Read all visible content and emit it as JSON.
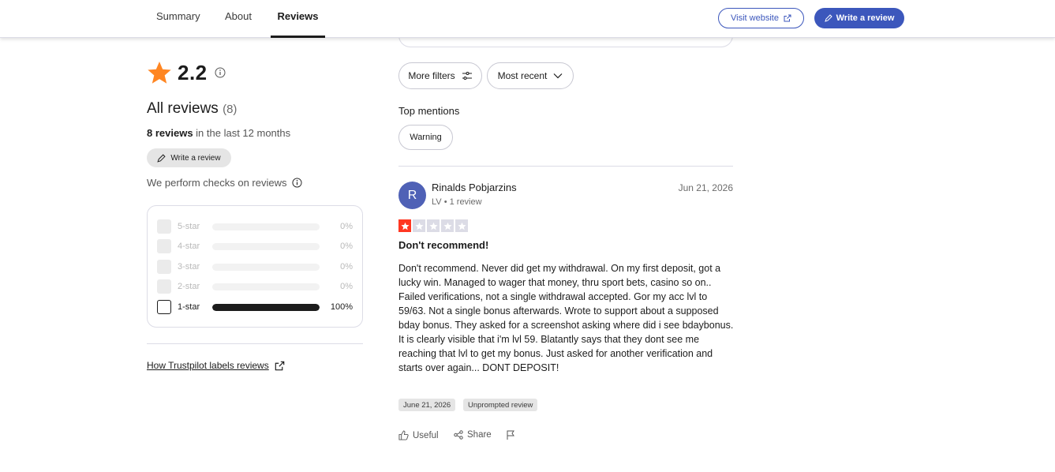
{
  "nav": {
    "tabs": [
      {
        "label": "Summary"
      },
      {
        "label": "About"
      },
      {
        "label": "Reviews"
      }
    ],
    "visit_website": "Visit website",
    "write_review": "Write a review"
  },
  "summary": {
    "rating": "2.2",
    "all_reviews_label": "All reviews",
    "all_reviews_count": "(8)",
    "reviews_count_bold": "8 reviews",
    "reviews_period": " in the last 12 months",
    "write_review": "Write a review",
    "checks_text": "We perform checks on reviews",
    "distribution": [
      {
        "label": "5-star",
        "percent_text": "0%",
        "percent": 0
      },
      {
        "label": "4-star",
        "percent_text": "0%",
        "percent": 0
      },
      {
        "label": "3-star",
        "percent_text": "0%",
        "percent": 0
      },
      {
        "label": "2-star",
        "percent_text": "0%",
        "percent": 0
      },
      {
        "label": "1-star",
        "percent_text": "100%",
        "percent": 100
      }
    ],
    "labels_link": "How Trustpilot labels reviews"
  },
  "filters": {
    "more_filters": "More filters",
    "sort": "Most recent",
    "top_mentions_title": "Top mentions",
    "mentions": [
      "Warning"
    ]
  },
  "review": {
    "avatar_initial": "R",
    "name": "Rinalds Pobjarzins",
    "meta": "LV • 1 review",
    "date": "Jun 21, 2026",
    "stars": 1,
    "title": "Don't recommend!",
    "body": "Don't recommend. Never did get my withdrawal. On my first deposit, got a lucky win. Managed to wager that money, thru sport bets, casino so on.. Failed verifications, not a single withdrawal accepted. Gor my acc lvl to 59/63. Not a single bonus afterwards. Wrote to support about a supposed bday bonus. They asked for a screenshot asking where did i see bdaybonus. It is clearly visible that i'm lvl 59. Blatantly says that they dont see me reaching that lvl to get my bonus. Just asked for another verification and starts over again... DONT DEPOSIT!",
    "tag_date": "June 21, 2026",
    "tag_unprompted": "Unprompted review",
    "useful": "Useful",
    "share": "Share"
  },
  "colors": {
    "brand_blue": "#3c57bc",
    "star_orange": "#ff8622",
    "review_star_red": "#ff3722",
    "avatar_blue": "#4f61b6"
  }
}
